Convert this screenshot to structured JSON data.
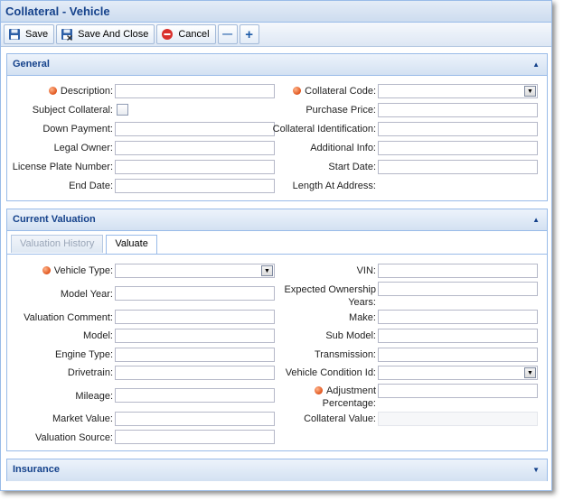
{
  "window": {
    "title": "Collateral - Vehicle"
  },
  "toolbar": {
    "save_label": "Save",
    "save_close_label": "Save And Close",
    "cancel_label": "Cancel",
    "minus_label": "—",
    "plus_label": "+"
  },
  "general": {
    "header": "General",
    "fields": {
      "description": "Description:",
      "collateral_code": "Collateral Code:",
      "subject_collateral": "Subject Collateral:",
      "purchase_price": "Purchase Price:",
      "down_payment": "Down Payment:",
      "collateral_identification": "Collateral Identification:",
      "legal_owner": "Legal Owner:",
      "additional_info": "Additional Info:",
      "license_plate_number": "License Plate Number:",
      "start_date": "Start Date:",
      "end_date": "End Date:",
      "length_at_address": "Length At Address:"
    }
  },
  "valuation": {
    "header": "Current Valuation",
    "tabs": [
      "Valuation History",
      "Valuate"
    ],
    "fields": {
      "vehicle_type": "Vehicle Type:",
      "vin": "VIN:",
      "model_year": "Model Year:",
      "expected_ownership_years_1": "Expected Ownership",
      "expected_ownership_years_2": "Years:",
      "valuation_comment": "Valuation Comment:",
      "make": "Make:",
      "model": "Model:",
      "sub_model": "Sub Model:",
      "engine_type": "Engine Type:",
      "transmission": "Transmission:",
      "drivetrain": "Drivetrain:",
      "vehicle_condition_id": "Vehicle Condition Id:",
      "mileage": "Mileage:",
      "adjustment_percentage_1": "Adjustment",
      "adjustment_percentage_2": "Percentage:",
      "market_value": "Market Value:",
      "collateral_value": "Collateral Value:",
      "valuation_source": "Valuation Source:"
    }
  },
  "insurance": {
    "header": "Insurance"
  },
  "icons": {
    "save": "floppy-disk-icon",
    "save_close": "floppy-disk-close-icon",
    "cancel": "cancel-icon",
    "required": "required-dot-icon",
    "collapse": "triangle-up-icon",
    "expand": "triangle-down-icon",
    "dropdown": "dropdown-arrow-icon"
  },
  "colors": {
    "header_text": "#15428b",
    "required": "#e0541c",
    "border": "#99bbe8"
  }
}
